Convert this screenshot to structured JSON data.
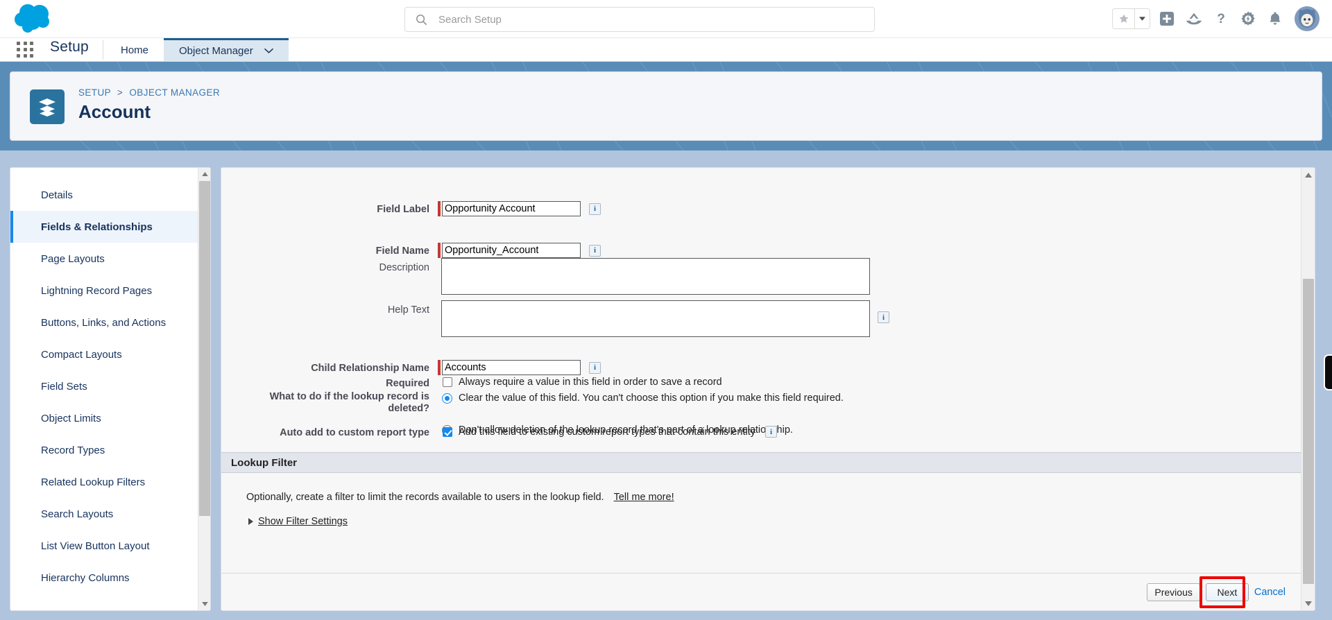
{
  "header": {
    "logo_icon": "salesforce-cloud-logo",
    "search": {
      "placeholder": "Search Setup",
      "value": "",
      "icon": "search-icon"
    },
    "icons": [
      {
        "name": "favorites-star-icon",
        "glyph": "star"
      },
      {
        "name": "favorites-dropdown-icon",
        "glyph": "caret-down"
      },
      {
        "name": "global-actions-icon",
        "glyph": "plus-square"
      },
      {
        "name": "trailhead-icon",
        "glyph": "mountain"
      },
      {
        "name": "help-icon",
        "glyph": "question-mark"
      },
      {
        "name": "setup-gear-icon",
        "glyph": "gear"
      },
      {
        "name": "notifications-bell-icon",
        "glyph": "bell"
      },
      {
        "name": "user-avatar",
        "glyph": "astro-avatar"
      }
    ]
  },
  "setup_bar": {
    "app_launcher_icon": "app-launcher-waffle-icon",
    "app_name": "Setup",
    "tabs": [
      {
        "label": "Home",
        "active": false,
        "has_caret": false
      },
      {
        "label": "Object Manager",
        "active": true,
        "has_caret": true
      }
    ]
  },
  "page_header": {
    "icon": "object-manager-stack-icon",
    "breadcrumb": [
      "SETUP",
      "OBJECT MANAGER"
    ],
    "separator": ">",
    "title": "Account"
  },
  "sidebar": {
    "items": [
      {
        "label": "Details",
        "active": false
      },
      {
        "label": "Fields & Relationships",
        "active": true
      },
      {
        "label": "Page Layouts",
        "active": false
      },
      {
        "label": "Lightning Record Pages",
        "active": false
      },
      {
        "label": "Buttons, Links, and Actions",
        "active": false
      },
      {
        "label": "Compact Layouts",
        "active": false
      },
      {
        "label": "Field Sets",
        "active": false
      },
      {
        "label": "Object Limits",
        "active": false
      },
      {
        "label": "Record Types",
        "active": false
      },
      {
        "label": "Related Lookup Filters",
        "active": false
      },
      {
        "label": "Search Layouts",
        "active": false
      },
      {
        "label": "List View Button Layout",
        "active": false
      },
      {
        "label": "Hierarchy Columns",
        "active": false
      }
    ],
    "scrollbar": {
      "up_icon": "scroll-up-arrow-icon",
      "down_icon": "scroll-down-arrow-icon"
    }
  },
  "form": {
    "field_label": {
      "label": "Field Label",
      "value": "Opportunity Account",
      "required": true,
      "info_icon": "info-icon"
    },
    "field_name": {
      "label": "Field Name",
      "value": "Opportunity_Account",
      "required": true,
      "info_icon": "info-icon"
    },
    "description": {
      "label": "Description",
      "value": "",
      "required": false
    },
    "help_text": {
      "label": "Help Text",
      "value": "",
      "required": false,
      "info_icon": "info-icon"
    },
    "child_relationship_name": {
      "label": "Child Relationship Name",
      "value": "Accounts",
      "required": true,
      "info_icon": "info-icon"
    },
    "required_field": {
      "label": "Required",
      "option": "Always require a value in this field in order to save a record",
      "checked": false
    },
    "delete_behavior": {
      "label": "What to do if the lookup record is deleted?",
      "options": [
        {
          "text": "Clear the value of this field. You can't choose this option if you make this field required.",
          "selected": true
        },
        {
          "text": "Don't allow deletion of the lookup record that's part of a lookup relationship.",
          "selected": false
        }
      ]
    },
    "auto_add_report_type": {
      "label": "Auto add to custom report type",
      "option": "Add this field to existing custom report types that contain this entity",
      "checked": true,
      "info_icon": "info-icon"
    }
  },
  "lookup_filter": {
    "section_title": "Lookup Filter",
    "description": "Optionally, create a filter to limit the records available to users in the lookup field.",
    "tell_me_more": "Tell me more!",
    "toggle_label": "Show Filter Settings",
    "toggle_icon": "disclosure-triangle-right-icon"
  },
  "footer": {
    "previous": "Previous",
    "next": "Next",
    "cancel": "Cancel",
    "highlight_color": "#ee0000"
  },
  "colors": {
    "brand_blue": "#1589ee",
    "header_blue": "#5a8cb8",
    "body_blue": "#b0c4de",
    "active_nav": "#eef4fb",
    "required_red": "#c23934"
  }
}
